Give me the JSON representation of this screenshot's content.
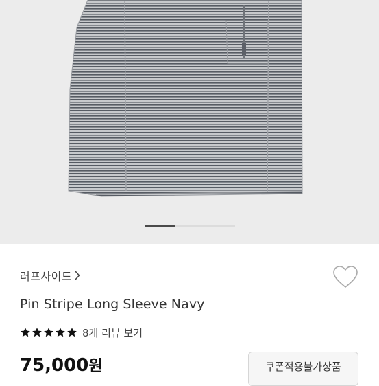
{
  "gallery": {
    "image_alt": "Pin Stripe Long Sleeve Navy",
    "slide_count": 3,
    "active_slide": 1,
    "background": "#ececec"
  },
  "product": {
    "brand": "러프사이드",
    "title": "Pin Stripe Long Sleeve Navy",
    "rating": 5,
    "review_link": "8개 리뷰 보기",
    "price": "75,000",
    "price_unit": "원",
    "coupon_button": "쿠폰적용불가상품"
  },
  "icons": {
    "brand_chevron": "chevron-right-icon",
    "like": "heart-outline-icon",
    "star": "star-icon"
  },
  "colors": {
    "star": "#111111",
    "indicator_active": "#4a4a4a",
    "indicator_inactive": "#dcdcdc"
  }
}
